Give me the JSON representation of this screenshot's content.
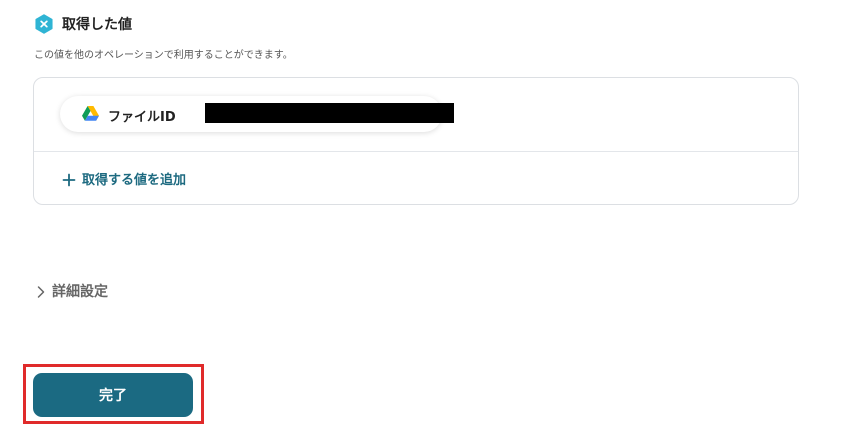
{
  "section": {
    "title": "取得した値",
    "description": "この値を他のオペレーションで利用することができます。"
  },
  "values_card": {
    "items": [
      {
        "icon": "google-drive-icon",
        "label": "ファイルID",
        "value_redacted": true
      }
    ],
    "add_label": "取得する値を追加"
  },
  "advanced": {
    "label": "詳細設定"
  },
  "footer": {
    "done_label": "完了"
  },
  "colors": {
    "accent": "#1b6a82",
    "link": "#1d6a80",
    "highlight": "#e02a2a",
    "badge": "#2fb4d4"
  }
}
